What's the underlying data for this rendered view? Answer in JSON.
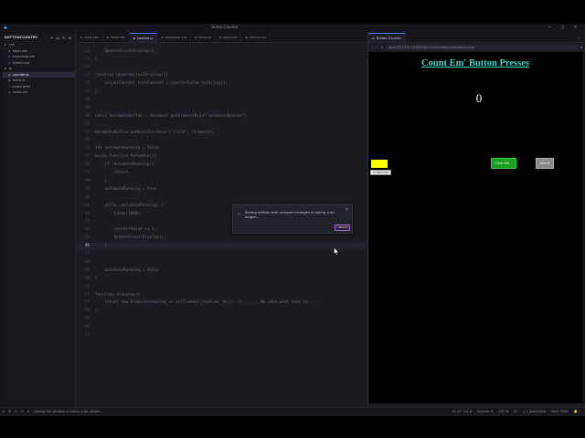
{
  "window": {
    "title": "ButtonCounter"
  },
  "sidebar": {
    "title": "BUTTONCOUNTER",
    "files": [
      {
        "name": "css",
        "kind": "folder"
      },
      {
        "name": "style.css",
        "kind": "css"
      },
      {
        "name": "tokyonise.css",
        "kind": "css"
      },
      {
        "name": "theme.css",
        "kind": "css"
      },
      {
        "name": "js",
        "kind": "folder"
      },
      {
        "name": "counter.js",
        "kind": "js",
        "active": true
      },
      {
        "name": "extra.js",
        "kind": "js"
      },
      {
        "name": "index.html",
        "kind": "html"
      },
      {
        "name": "notes.txt",
        "kind": "txt"
      }
    ]
  },
  "editor_tabs": [
    {
      "label": "style.css"
    },
    {
      "label": "notes.txt"
    },
    {
      "label": "counter.js",
      "active": true
    },
    {
      "label": "tokyonise.css"
    },
    {
      "label": "extra.js"
    },
    {
      "label": "style.css"
    },
    {
      "label": "theme.css"
    }
  ],
  "code_lines": [
    {
      "n": "22",
      "text": "    UpdateVisualDisplay();"
    },
    {
      "n": "23",
      "text": "}"
    },
    {
      "n": "24",
      "text": ""
    },
    {
      "n": "25",
      "text": "function UpdateVisualDisplay(){"
    },
    {
      "n": "26",
      "text": "    visualCounter.textContent = counterValue.toString();"
    },
    {
      "n": "27",
      "text": "}"
    },
    {
      "n": "28",
      "text": ""
    },
    {
      "n": "29",
      "text": ""
    },
    {
      "n": "30",
      "text": "const automateButton = document.getElementById(\"automateButton\")"
    },
    {
      "n": "31",
      "text": ""
    },
    {
      "n": "32",
      "text": "automateButton.addEventListener('click', Automate)"
    },
    {
      "n": "33",
      "text": ""
    },
    {
      "n": "34",
      "text": "let automateRunning = false"
    },
    {
      "n": "35",
      "text": "async function Automate(){"
    },
    {
      "n": "36",
      "text": "    if (automateRunning){"
    },
    {
      "n": "37",
      "text": "        return"
    },
    {
      "n": "38",
      "text": "    }"
    },
    {
      "n": "39",
      "text": "    automateRunning = true"
    },
    {
      "n": "40",
      "text": ""
    },
    {
      "n": "41",
      "text": "    while (automateRunning) {"
    },
    {
      "n": "42",
      "text": "        sleep(1000)"
    },
    {
      "n": "43",
      "text": ""
    },
    {
      "n": "44",
      "text": "        counterValue += 1;"
    },
    {
      "n": "45",
      "text": "        UpdateVisualDisplay();"
    },
    {
      "n": "46",
      "text": "    }",
      "current": true
    },
    {
      "n": "47",
      "text": ""
    },
    {
      "n": "48",
      "text": ""
    },
    {
      "n": "49",
      "text": "    automateRunning = false"
    },
    {
      "n": "50",
      "text": "}"
    },
    {
      "n": "51",
      "text": ""
    },
    {
      "n": "52",
      "text": "function sleep(ms){"
    },
    {
      "n": "53",
      "text": "    return new Promise(resolve => setTimeout(resolve, ms)); // ...... No idea what this is ..."
    },
    {
      "n": "54",
      "text": "}"
    },
    {
      "n": "55",
      "text": ""
    },
    {
      "n": "56",
      "text": ""
    },
    {
      "n": "57",
      "text": ""
    }
  ],
  "notification": {
    "message": "Saving editors with unsaved changes is taking a bit longer...",
    "cancel_label": "Cancel"
  },
  "browser": {
    "tab_label": "Button Counter",
    "url": "http://127.0.0.1:3000/index.html?vscode-livepreview=true",
    "heading": "Count Em' Button Presses",
    "counter_value": "0",
    "tooltip": "Automate",
    "green_button": "Click Me...",
    "reset_button": "Reset"
  },
  "status": {
    "left_errors": "0",
    "left_warnings": "0",
    "left_message": "Closing the window is taking a bit longer...",
    "position": "Ln 17, Col 6",
    "spaces": "Spaces: 4",
    "encoding": "UTF-8",
    "eol": "LF",
    "language": "{ } JavaScript",
    "port": "Port: 3000"
  }
}
